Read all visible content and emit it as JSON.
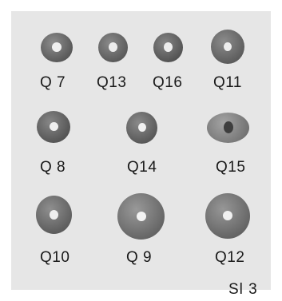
{
  "plate": {
    "background": "#e6e6e6",
    "id_label": "Sl 3"
  },
  "beads": [
    {
      "label": "Q 7"
    },
    {
      "label": "Q13"
    },
    {
      "label": "Q16"
    },
    {
      "label": "Q11"
    },
    {
      "label": "Q 8"
    },
    {
      "label": "Q14"
    },
    {
      "label": "Q15"
    },
    {
      "label": "Q10"
    },
    {
      "label": "Q 9"
    },
    {
      "label": "Q12"
    }
  ]
}
